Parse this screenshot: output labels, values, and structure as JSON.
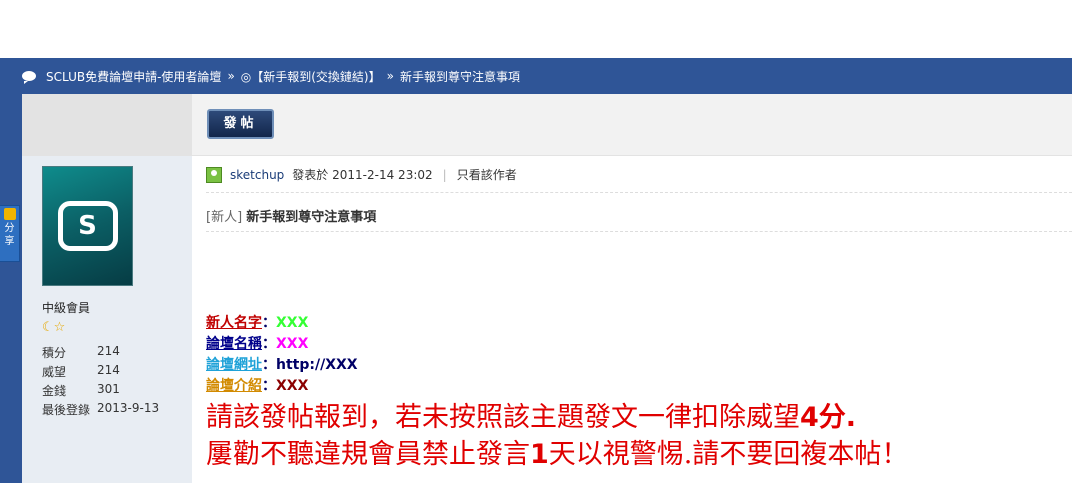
{
  "breadcrumb": {
    "items": [
      "SCLUB免費論壇申請-使用者論壇",
      "◎【新手報到(交換鏈結)】",
      "新手報到尊守注意事項"
    ],
    "separator": "»"
  },
  "share": {
    "label_1": "分",
    "label_2": "享"
  },
  "toolbar": {
    "post_label": "發帖"
  },
  "user": {
    "rank": "中級會員",
    "stars": "☾☆",
    "stats": [
      {
        "label": "積分",
        "value": "214"
      },
      {
        "label": "威望",
        "value": "214"
      },
      {
        "label": "金錢",
        "value": "301"
      },
      {
        "label": "最後登錄",
        "value": "2013-9-13"
      }
    ]
  },
  "post": {
    "author": "sketchup",
    "posted_prefix": "發表於",
    "datetime": "2011-2-14 23:02",
    "only_author": "只看該作者",
    "tag": "[新人]",
    "title": "新手報到尊守注意事項"
  },
  "form": {
    "name_label": "新人名字",
    "name_value": "XXX",
    "forum_name_label": "論壇名稱",
    "forum_name_value": "XXX",
    "forum_url_label": "論壇網址",
    "forum_url_value": "http://XXX",
    "forum_intro_label": "論壇介紹",
    "forum_intro_value": "XXX",
    "colon": "："
  },
  "warning": {
    "line1_a": "請該發帖報到，若未按照該主題發文一律扣除威望",
    "line1_num": "4",
    "line1_b": "分.",
    "line2_a": "屢勸不聽違規會員禁止發言",
    "line2_num": "1",
    "line2_b": "天以視警惕.請不要回複本帖！"
  },
  "colors": {
    "header_blue": "#2f5597",
    "warning_red": "#e00000"
  }
}
